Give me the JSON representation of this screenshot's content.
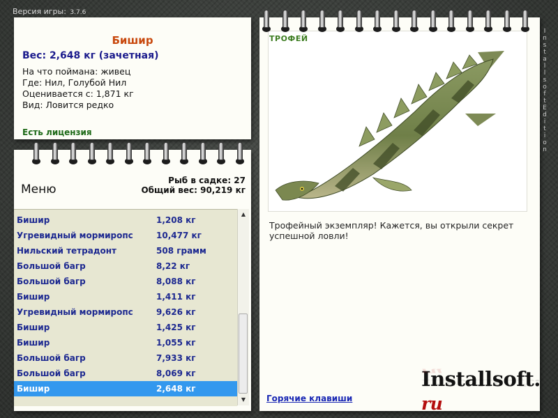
{
  "version": {
    "label": "Версия игры:",
    "number": "3.7.6"
  },
  "catch_card": {
    "fish_name": "Бишир",
    "weight_line": "Вес: 2,648 кг (зачетная)",
    "bait_line": "На что поймана: живец",
    "place_line": "Где: Нил, Голубой Нил",
    "value_line": "Оценивается с: 1,871 кг",
    "type_line": "Вид: Ловится редко",
    "license": "Есть лицензия"
  },
  "menu": {
    "title": "Меню",
    "fish_count": "Рыб в садке: 27",
    "total_weight": "Общий вес: 90,219 кг",
    "rows": [
      {
        "name": "Бишир",
        "weight": "1,208 кг"
      },
      {
        "name": "Угревидный мормиропс",
        "weight": "10,477 кг"
      },
      {
        "name": "Нильский тетрадонт",
        "weight": "508 грамм"
      },
      {
        "name": "Большой багр",
        "weight": "8,22 кг"
      },
      {
        "name": "Большой багр",
        "weight": "8,088 кг"
      },
      {
        "name": "Бишир",
        "weight": "1,411 кг"
      },
      {
        "name": "Угревидный мормиропс",
        "weight": "9,626 кг"
      },
      {
        "name": "Бишир",
        "weight": "1,425 кг"
      },
      {
        "name": "Бишир",
        "weight": "1,055 кг"
      },
      {
        "name": "Большой багр",
        "weight": "7,933 кг"
      },
      {
        "name": "Большой багр",
        "weight": "8,069 кг"
      },
      {
        "name": "Бишир",
        "weight": "2,648 кг"
      }
    ],
    "selected_index": 11
  },
  "trophy": {
    "label": "ТРОФЕЙ",
    "text": "Трофейный экземпляр! Кажется, вы открыли секрет успешной ловли!",
    "hotkeys_link": "Горячие клавиши",
    "logo_main": "Installsoft.",
    "logo_suffix": "ru"
  },
  "side_text": "InstallsoftEdition",
  "colors": {
    "fish_name": "#c8480d",
    "weight": "#1a1a8c",
    "license": "#1e6a18",
    "row_text": "#1c2890",
    "selection": "#3398ee",
    "trophy_label": "#3c7c20"
  },
  "icons": {
    "rings": "binder-ring-icon",
    "fish": "fish-illustration"
  }
}
